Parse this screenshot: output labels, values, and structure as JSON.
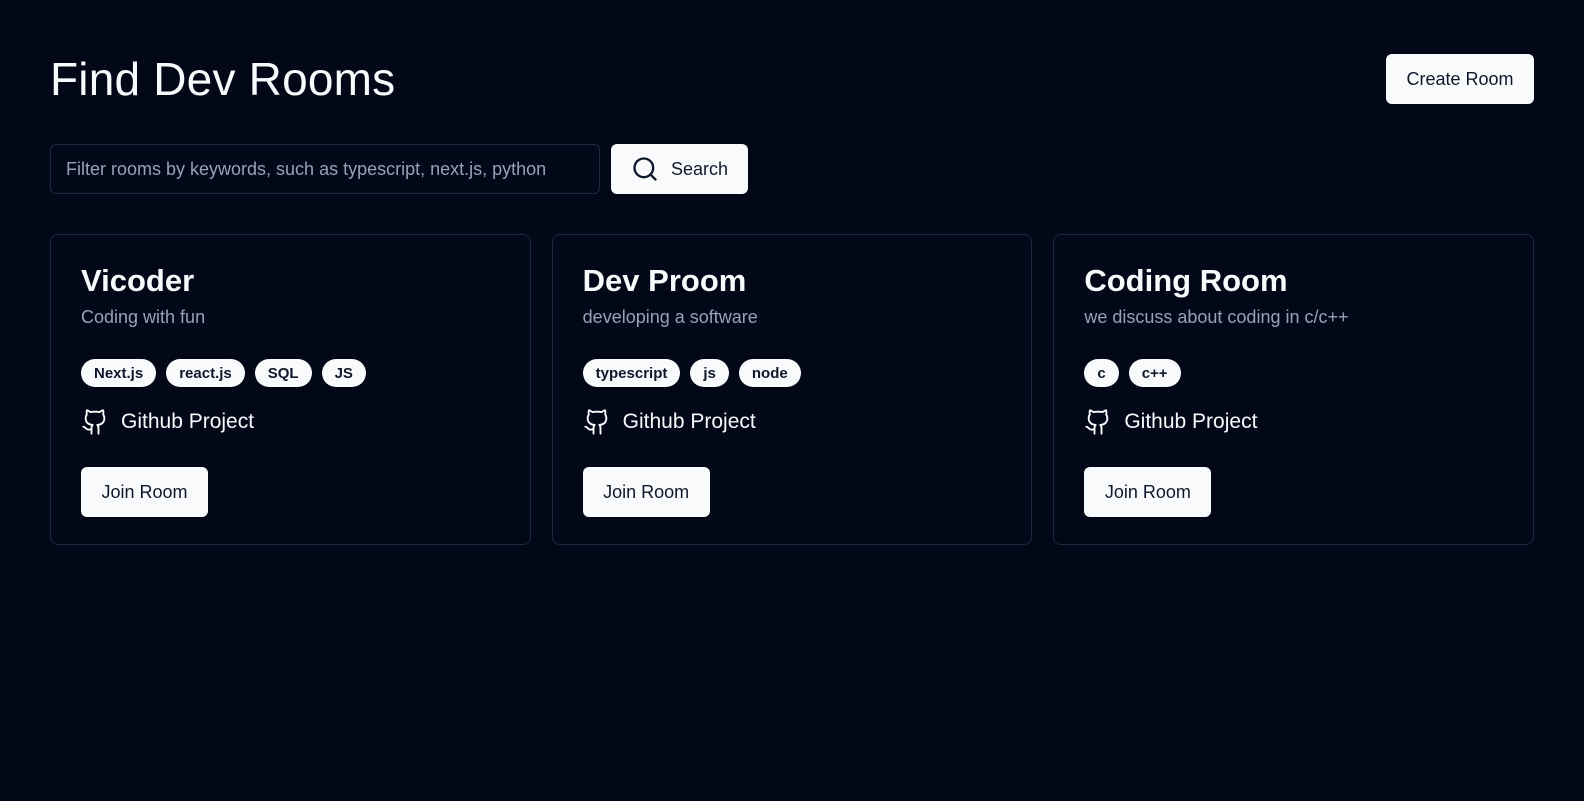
{
  "header": {
    "title": "Find Dev Rooms",
    "create_label": "Create Room"
  },
  "search": {
    "placeholder": "Filter rooms by keywords, such as typescript, next.js, python",
    "value": "",
    "button_label": "Search",
    "icon": "search-icon"
  },
  "rooms": [
    {
      "name": "Vicoder",
      "description": "Coding with fun",
      "tags": [
        "Next.js",
        "react.js",
        "SQL",
        "JS"
      ],
      "github_label": "Github Project",
      "join_label": "Join Room"
    },
    {
      "name": "Dev Proom",
      "description": "developing a software",
      "tags": [
        "typescript",
        "js",
        "node"
      ],
      "github_label": "Github Project",
      "join_label": "Join Room"
    },
    {
      "name": "Coding Room",
      "description": "we discuss about coding in c/c++",
      "tags": [
        "c",
        "c++"
      ],
      "github_label": "Github Project",
      "join_label": "Join Room"
    }
  ],
  "colors": {
    "background": "#020817",
    "foreground": "#f8fafc",
    "muted": "#94a3b8",
    "border": "#1e293b",
    "button_bg": "#f8fafc",
    "button_text": "#0f172a"
  }
}
